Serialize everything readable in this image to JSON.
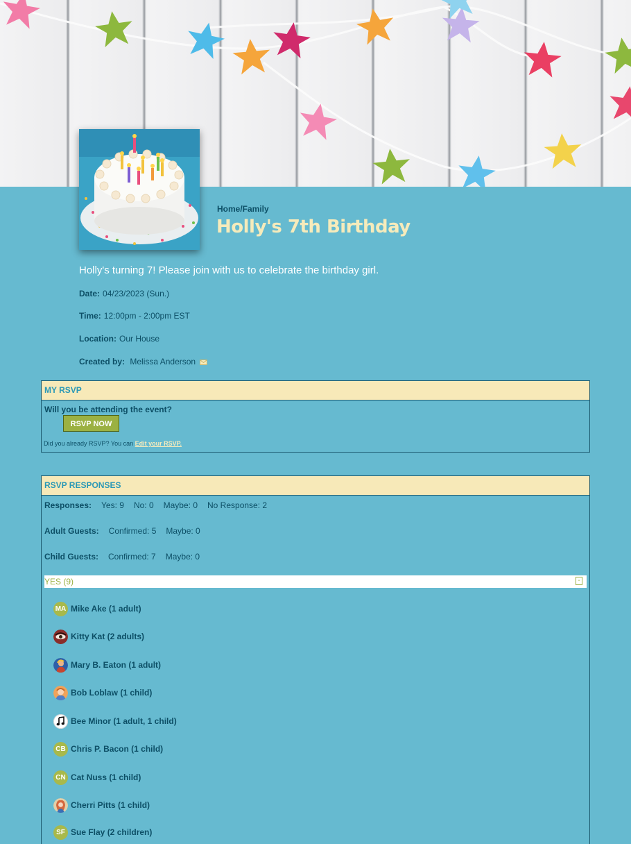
{
  "event": {
    "breadcrumb": "Home/Family",
    "title": "Holly's 7th Birthday",
    "intro": "Holly's turning 7! Please join with us to celebrate the birthday girl.",
    "details": {
      "date_label": "Date:",
      "date_value": "04/23/2023 (Sun.)",
      "time_label": "Time:",
      "time_value": "12:00pm - 2:00pm EST",
      "location_label": "Location:",
      "location_value": "Our House",
      "created_label": "Created by:",
      "created_value": "Melissa Anderson"
    }
  },
  "my_rsvp": {
    "header": "MY RSVP",
    "question": "Will you be attending the event?",
    "button": "RSVP NOW",
    "already_text": "Did you already RSVP? You can",
    "edit_link": "Edit your RSVP."
  },
  "responses": {
    "header": "RSVP RESPONSES",
    "responses_label": "Responses:",
    "yes": "Yes: 9",
    "no": "No: 0",
    "maybe": "Maybe: 0",
    "no_response": "No Response: 2",
    "adult_label": "Adult Guests:",
    "adult_confirmed": "Confirmed: 5",
    "adult_maybe": "Maybe: 0",
    "child_label": "Child Guests:",
    "child_confirmed": "Confirmed: 7",
    "child_maybe": "Maybe: 0",
    "yes_group_label": "YES (9)",
    "collapse_symbol": "-",
    "guests": [
      {
        "initials": "MA",
        "name": "Mike Ake (1 adult)"
      },
      {
        "avatar": "eye-photo",
        "name": "Kitty Kat (2 adults)"
      },
      {
        "avatar": "portrait-photo",
        "name": "Mary B. Eaton (1 adult)"
      },
      {
        "avatar": "portrait-photo",
        "name": "Bob Loblaw (1 child)"
      },
      {
        "avatar": "music-note",
        "name": "Bee Minor (1 adult, 1 child)"
      },
      {
        "initials": "CB",
        "name": "Chris P. Bacon (1 child)"
      },
      {
        "initials": "CN",
        "name": "Cat Nuss (1 child)"
      },
      {
        "avatar": "portrait-photo",
        "name": "Cherri Pitts (1 child)"
      },
      {
        "initials": "SF",
        "name": "Sue Flay (2 children)"
      }
    ]
  },
  "colors": {
    "page_bg": "#66bad0",
    "title": "#f6ebbb",
    "panel_header_bg": "#f7e9b8",
    "panel_header_text": "#2a98b6",
    "button_bg": "#9bb142",
    "text": "#0d4f66"
  }
}
